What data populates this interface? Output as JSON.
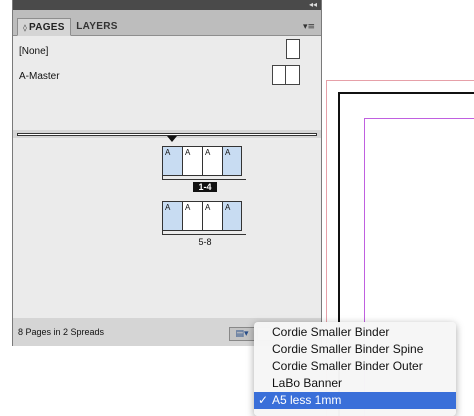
{
  "panel": {
    "collapse_glyph": "◂◂",
    "tabs": [
      {
        "label": "PAGES",
        "glyph": "◊",
        "selected": true
      },
      {
        "label": "LAYERS",
        "selected": false
      }
    ],
    "menu_glyph": "▾≡"
  },
  "masters": {
    "items": [
      {
        "label": "[None]",
        "pages": 1
      },
      {
        "label": "A-Master",
        "pages": 2
      }
    ]
  },
  "pages": {
    "spreads": [
      {
        "label": "1-4",
        "selected": true,
        "pages": [
          "A",
          "A",
          "A",
          "A"
        ],
        "selected_pages": [
          0,
          3
        ]
      },
      {
        "label": "5-8",
        "selected": false,
        "pages": [
          "A",
          "A",
          "A",
          "A"
        ],
        "selected_pages": [
          0,
          3
        ]
      }
    ]
  },
  "status": {
    "text": "8 Pages in 2 Spreads",
    "edit_size_glyph": "▤▾"
  },
  "menu": {
    "check_glyph": "✓",
    "items": [
      {
        "label": "Cordie Smaller Binder",
        "checked": false
      },
      {
        "label": "Cordie Smaller Binder Spine",
        "checked": false
      },
      {
        "label": "Cordie Smaller Binder Outer",
        "checked": false
      },
      {
        "label": "LaBo Banner",
        "checked": false
      },
      {
        "label": "A5 less 1mm",
        "checked": true
      }
    ]
  },
  "colors": {
    "highlight": "#3a6fd9",
    "selected_page": "#c8dcf2",
    "bleed_guide": "#e6a0a8",
    "margin_guide": "#c060e0"
  }
}
